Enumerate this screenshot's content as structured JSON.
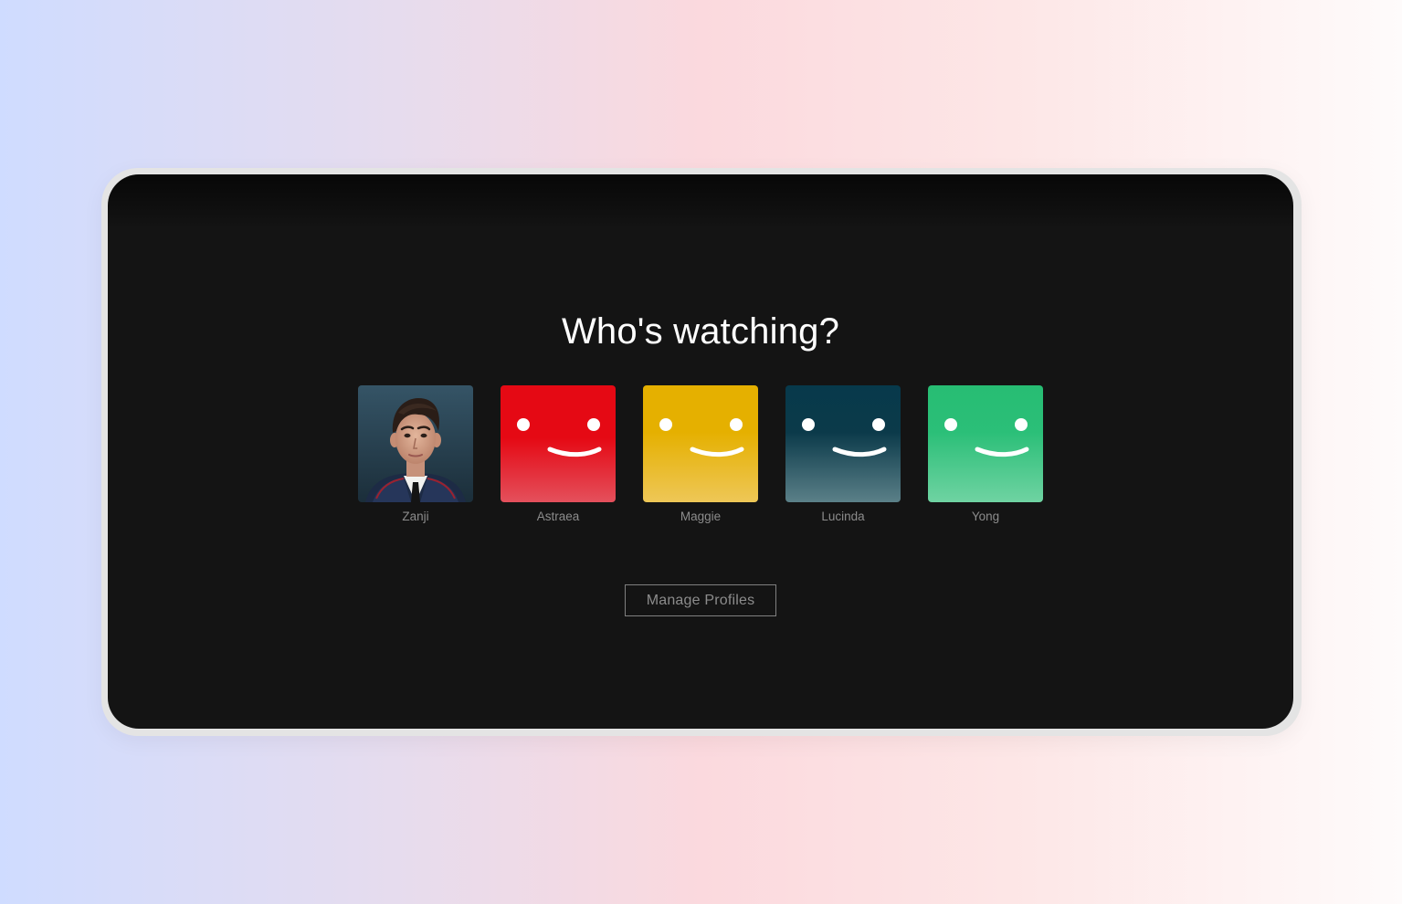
{
  "heading": "Who's watching?",
  "profiles": [
    {
      "name": "Zanji",
      "avatar": "photo-portrait",
      "colors": [
        "#2c4a5c",
        "#1a2d38"
      ]
    },
    {
      "name": "Astraea",
      "avatar": "smiley-icon",
      "colors": [
        "#e50914",
        "#e4505c"
      ]
    },
    {
      "name": "Maggie",
      "avatar": "smiley-icon",
      "colors": [
        "#e5b000",
        "#eec757"
      ]
    },
    {
      "name": "Lucinda",
      "avatar": "smiley-icon",
      "colors": [
        "#07394b",
        "#5b8088"
      ]
    },
    {
      "name": "Yong",
      "avatar": "smiley-icon",
      "colors": [
        "#27bd73",
        "#6fd3a2"
      ]
    }
  ],
  "manage_button": "Manage Profiles",
  "colors": {
    "background": "#141414",
    "heading_text": "#ffffff",
    "muted_text": "#8c8c8c"
  }
}
